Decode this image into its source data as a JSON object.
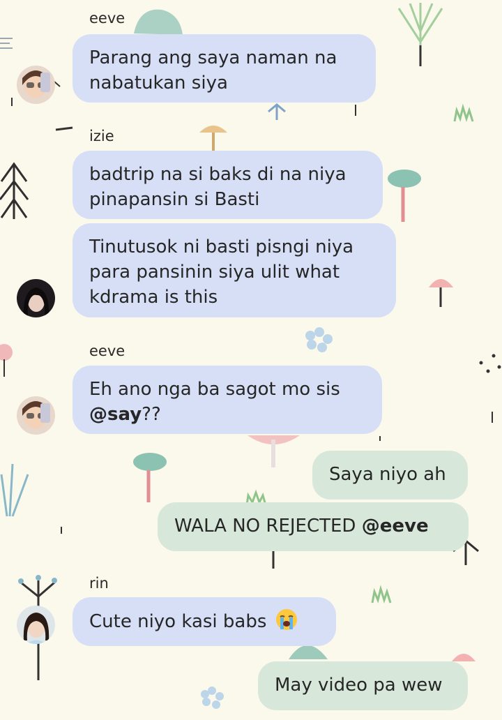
{
  "messages": [
    {
      "sender": "eeve",
      "text": "Parang ang saya naman na nabatukan siya"
    },
    {
      "sender": "izie",
      "text": "badtrip na si baks di na niya pinapansin si Basti"
    },
    {
      "text": "Tinutusok ni basti pisngi niya para pansinin siya ulit what kdrama is this"
    },
    {
      "sender": "eeve",
      "text": "Eh ano nga ba sagot mo sis ",
      "mention": "@say",
      "suffix": "??"
    },
    {
      "text": "Saya niyo ah"
    },
    {
      "text": "WALA NO REJECTED ",
      "mention": "@eeve"
    },
    {
      "sender": "rin",
      "text": "Cute niyo kasi babs "
    },
    {
      "text": "May video pa wew"
    }
  ],
  "avatars": [
    "eeve-avatar",
    "izie-avatar",
    "eeve-avatar",
    "rin-avatar"
  ],
  "emoji": "loudly-crying-face-icon",
  "colors": {
    "background": "#fbf8ec",
    "incoming_bubble": "#d6dff5",
    "outgoing_bubble": "#d7e8da"
  }
}
